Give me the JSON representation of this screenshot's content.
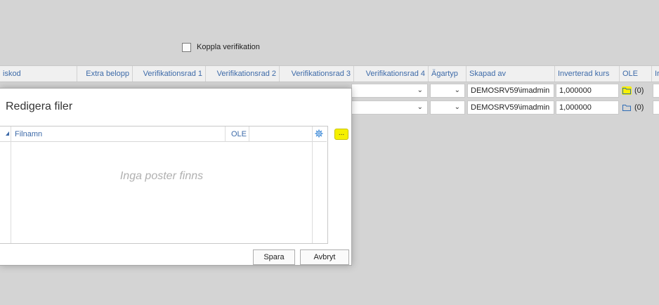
{
  "koppla_label": "Koppla verifikation",
  "header": {
    "col_skod": "iskod",
    "col_extra": "Extra belopp",
    "col_v1": "Verifikationsrad 1",
    "col_v2": "Verifikationsrad 2",
    "col_v3": "Verifikationsrad 3",
    "col_v4": "Verifikationsrad 4",
    "col_agartyp": "Ägartyp",
    "col_skapad": "Skapad av",
    "col_kurs": "Inverterad kurs",
    "col_ole": "OLE",
    "col_extra2": "Ir"
  },
  "rows": [
    {
      "skapad": "DEMOSRV59\\imadmin",
      "kurs": "1,000000",
      "ole_count": "(0)"
    },
    {
      "skapad": "DEMOSRV59\\imadmin",
      "kurs": "1,000000",
      "ole_count": "(0)"
    }
  ],
  "dialog": {
    "title": "Redigera filer",
    "col_filnamn": "Filnamn",
    "col_ole": "OLE",
    "empty": "Inga poster finns",
    "dots": "...",
    "save": "Spara",
    "cancel": "Avbryt"
  },
  "colors": {
    "highlight": "#f8f000",
    "header_text": "#3d6aa8"
  },
  "icons": [
    "chevron-down-icon",
    "folder-icon",
    "gear-icon",
    "sort-indicator-icon"
  ]
}
